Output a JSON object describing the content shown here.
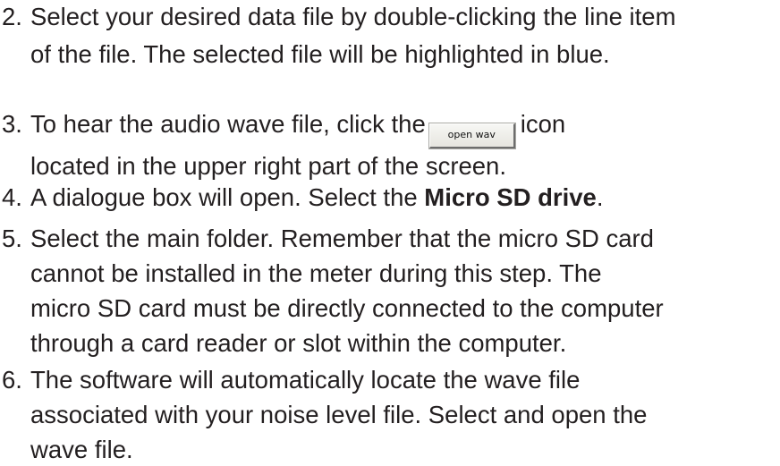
{
  "steps": [
    {
      "number": "2.",
      "lines": [
        "Select your desired data file by double-clicking the line item",
        "of the file. The selected file will be highlighted in blue."
      ]
    },
    {
      "number": "3.",
      "line1_before": "To hear the audio wave file, click the",
      "button_label": "open wav",
      "line1_after": "icon",
      "lines": [
        "located in the upper right part of the screen."
      ]
    },
    {
      "number": "4.",
      "text_before": "A dialogue box will open. Select the ",
      "bold_text": "Micro SD drive",
      "text_after": "."
    },
    {
      "number": "5.",
      "lines": [
        "Select the main folder. Remember that the micro SD card",
        "cannot be installed in the meter during this step. The",
        "micro SD card must be directly connected to the computer",
        "through a card reader or slot within the computer."
      ]
    },
    {
      "number": "6.",
      "lines": [
        "The software will automatically locate the wave file",
        "associated with your noise level file. Select and open the",
        "wave file."
      ]
    }
  ]
}
